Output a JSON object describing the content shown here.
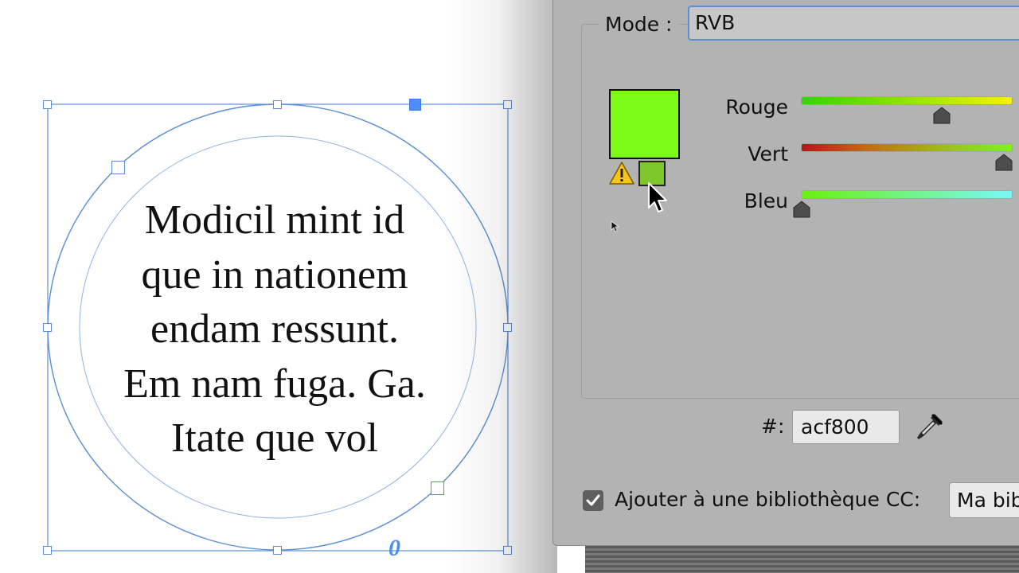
{
  "canvas": {
    "text_lines": [
      "Modicil mint id",
      "que in nationem",
      "endam ressunt.",
      "Em nam fuga. Ga.",
      "Itate que vol"
    ],
    "overflow_marker": "0",
    "frame_color": "#5a8ed8"
  },
  "dialog": {
    "mode_label": "Mode :",
    "mode_value": "RVB",
    "current_color": "#7cfc16",
    "gamut_color": "#7ec72a",
    "sliders": [
      {
        "label": "Rouge",
        "value": 172,
        "max": 255
      },
      {
        "label": "Vert",
        "value": 248,
        "max": 255
      },
      {
        "label": "Bleu",
        "value": 0,
        "max": 255
      }
    ],
    "hex_label": "#:",
    "hex_value": "acf800",
    "add_to_library_label": "Ajouter à une bibliothèque CC:",
    "add_to_library_checked": true,
    "library_value": "Ma bibliothèque"
  },
  "icons": {
    "gamut_warning": "warning-triangle-icon",
    "eyedropper": "eyedropper-icon",
    "cursor": "mouse-pointer-icon"
  }
}
